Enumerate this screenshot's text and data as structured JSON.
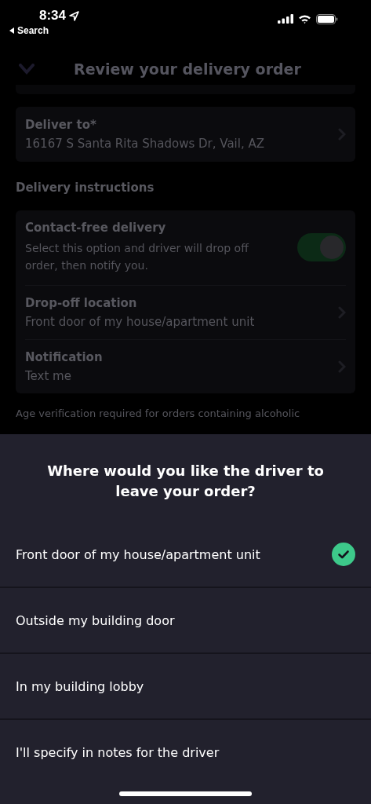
{
  "status_bar": {
    "time": "8:34",
    "back_label": "Search"
  },
  "header": {
    "title": "Review your delivery order"
  },
  "deliver_to": {
    "label": "Deliver to*",
    "value": "16167 S Santa Rita Shadows Dr, Vail, AZ"
  },
  "instructions": {
    "heading": "Delivery instructions",
    "contact_free": {
      "label": "Contact-free delivery",
      "description": "Select this option and driver will drop off order, then notify you.",
      "on": true
    },
    "rows": [
      {
        "label": "Drop-off location",
        "value": "Front door of my house/apartment unit"
      },
      {
        "label": "Notification",
        "value": "Text me"
      }
    ]
  },
  "footnote": "Age verification required for orders containing alcoholic",
  "sheet": {
    "title": "Where would you like the driver to leave your order?",
    "options": [
      {
        "label": "Front door of my house/apartment unit",
        "selected": true
      },
      {
        "label": "Outside my building door",
        "selected": false
      },
      {
        "label": "In my building lobby",
        "selected": false
      },
      {
        "label": "I'll specify in notes for the driver",
        "selected": false
      }
    ]
  }
}
